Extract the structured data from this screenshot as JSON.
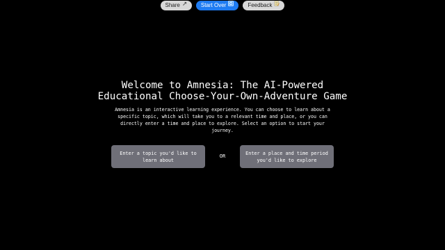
{
  "topbar": {
    "share_label": "Share",
    "start_over_label": "Start Over",
    "feedback_label": "Feedback",
    "accent_color": "#1f7cf2"
  },
  "main": {
    "title_line1": "Welcome to Amnesia: The AI-Powered",
    "title_line2": "Educational Choose-Your-Own-Adventure Game",
    "intro_lines": [
      "Amnesia is an interactive learning experience. You can choose to learn about a",
      "specific topic, which will take you to a relevant time and place, or you can",
      "directly enter a time and place to explore. Select an option to start your",
      "journey."
    ],
    "topic_button_lines": [
      "Enter a topic you'd like to",
      "learn about"
    ],
    "or_label": "OR",
    "place_button_lines": [
      "Enter a place and time period",
      "you'd like to explore"
    ]
  }
}
